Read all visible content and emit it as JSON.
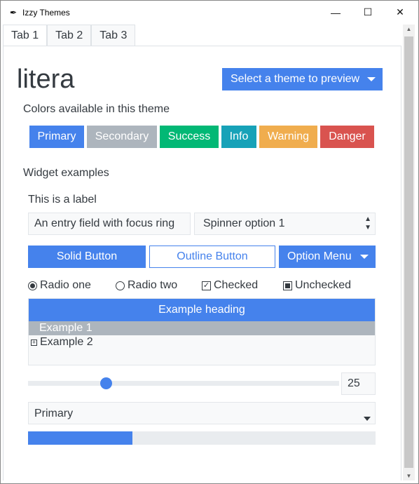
{
  "window": {
    "title": "Izzy Themes",
    "minimize": "—",
    "maximize": "☐",
    "close": "✕"
  },
  "tabs": [
    {
      "label": "Tab 1"
    },
    {
      "label": "Tab 2"
    },
    {
      "label": "Tab 3"
    }
  ],
  "theme_name": "litera",
  "theme_select": "Select a theme to preview",
  "colors_heading": "Colors available in this theme",
  "color_buttons": [
    {
      "label": "Primary",
      "color": "#4582ec"
    },
    {
      "label": "Secondary",
      "color": "#adb5bd"
    },
    {
      "label": "Success",
      "color": "#02b875"
    },
    {
      "label": "Info",
      "color": "#17a2b8"
    },
    {
      "label": "Warning",
      "color": "#f0ad4e"
    },
    {
      "label": "Danger",
      "color": "#d9534f"
    }
  ],
  "widgets_heading": "Widget examples",
  "label_text": "This is a label",
  "entry_value": "An entry field with focus ring",
  "spinner_value": "Spinner option 1",
  "solid_button": "Solid Button",
  "outline_button": "Outline Button",
  "option_menu": "Option Menu",
  "radio_one": "Radio one",
  "radio_two": "Radio two",
  "checked": "Checked",
  "unchecked": "Unchecked",
  "tree": {
    "heading": "Example heading",
    "items": [
      "Example 1",
      "Example 2"
    ]
  },
  "scale": {
    "value_percent": 25,
    "spinbox": "25"
  },
  "combo_value": "Primary",
  "progress_percent": 30
}
